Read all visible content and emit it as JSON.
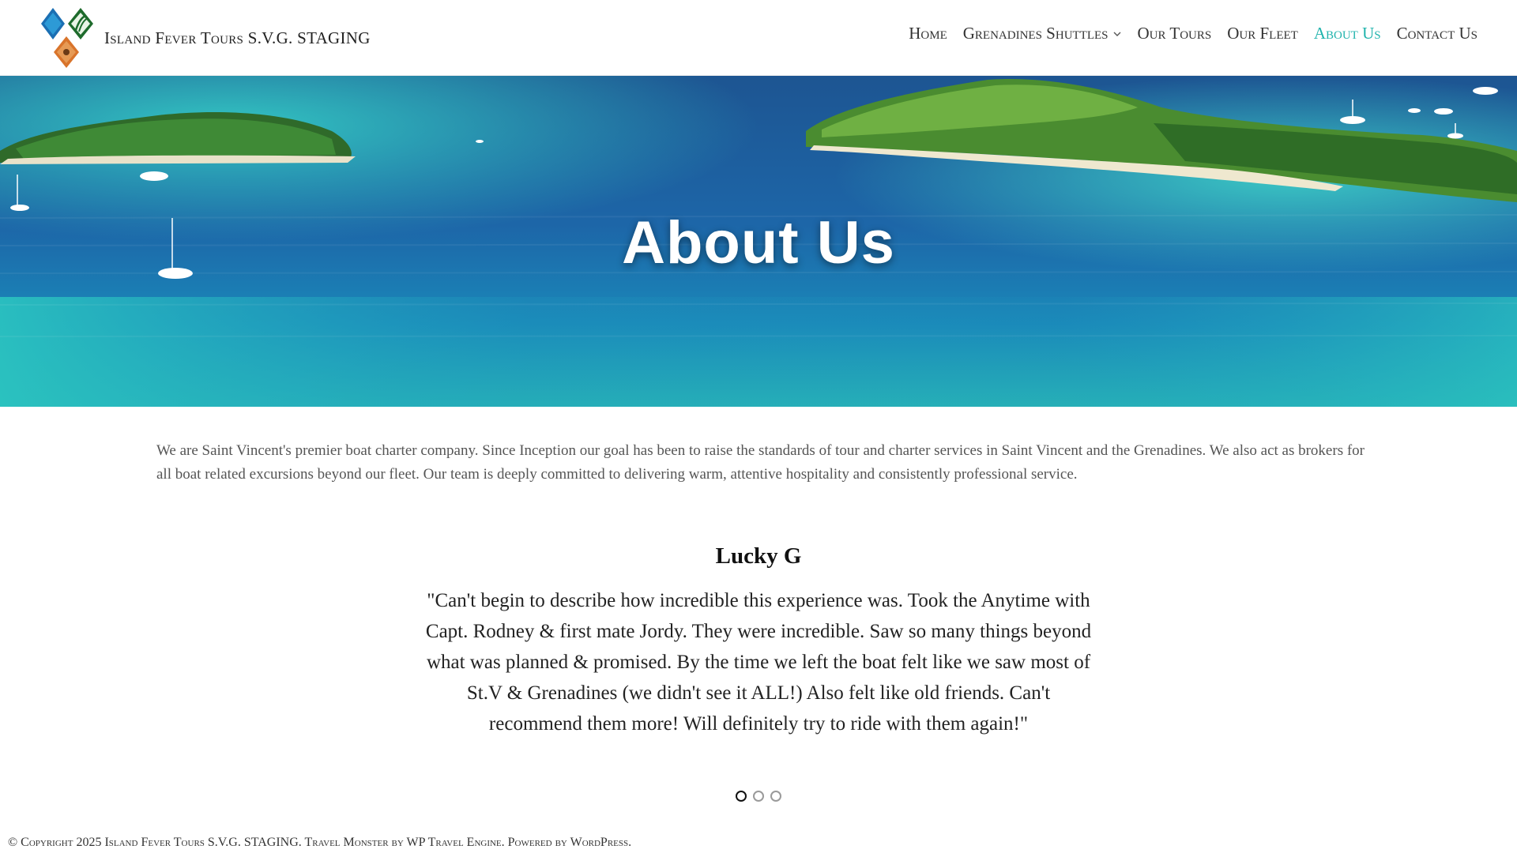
{
  "header": {
    "site_title": "Island Fever Tours S.V.G. STAGING",
    "logo_icon": "diamond-logo-icon",
    "nav": [
      {
        "label": "Home",
        "active": false
      },
      {
        "label": "Grenadines Shuttles",
        "active": false,
        "has_dropdown": true
      },
      {
        "label": "Our Tours",
        "active": false
      },
      {
        "label": "Our Fleet",
        "active": false
      },
      {
        "label": "About Us",
        "active": true
      },
      {
        "label": "Contact Us",
        "active": false
      }
    ],
    "accent_color": "#1fb3ac"
  },
  "hero": {
    "title": "About Us"
  },
  "intro": {
    "text": "We are Saint Vincent's premier boat charter company. Since Inception our goal has been to raise the standards of tour and charter services in Saint Vincent and the Grenadines.  We also act as brokers for all boat related excursions beyond our fleet. Our team is deeply committed to delivering warm, attentive hospitality and consistently professional service."
  },
  "testimonial": {
    "name": "Lucky G",
    "quote": "\"Can't begin to describe how incredible this experience was. Took the Anytime with Capt. Rodney & first mate Jordy. They were incredible. Saw so many things beyond what was planned & promised. By the time we left the boat felt like we saw most of St.V & Grenadines (we didn't see it ALL!) Also felt like old friends. Can't recommend them more! Will definitely try to ride with them again!\"",
    "slide_count": 3,
    "active_slide": 1
  },
  "footer": {
    "copyright": "© Copyright 2025 ",
    "site_link": "Island Fever Tours S.V.G. STAGING",
    "sep1": ". ",
    "theme": "Travel Monster",
    "by": " by ",
    "theme_author": "WP Travel Engine",
    "sep2": ". ",
    "powered": "Powered by ",
    "wordpress": "WordPress",
    "end": "."
  }
}
